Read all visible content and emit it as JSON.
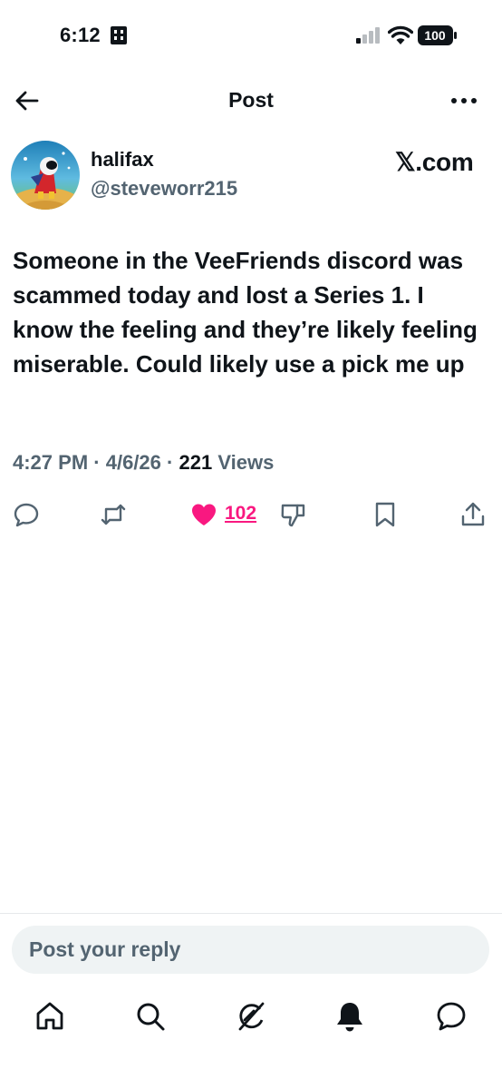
{
  "status_bar": {
    "time": "6:12",
    "battery": "100"
  },
  "header": {
    "title": "Post"
  },
  "author": {
    "name": "halifax",
    "handle": "@steveworr215"
  },
  "source_label": "𝕏.com",
  "post": {
    "text": "Someone in the VeeFriends discord was scammed today and lost a Series 1. I know the feeling and they’re likely feeling miserable. Could likely use a pick me up",
    "time": "4:27 PM",
    "separator": "·",
    "date": "4/6/26",
    "views_count": "221",
    "views_label": "Views"
  },
  "actions": {
    "like_count": "102"
  },
  "reply": {
    "placeholder": "Post your reply"
  },
  "colors": {
    "accent_like": "#f91880",
    "secondary_text": "#536471"
  },
  "icons": [
    "back-arrow-icon",
    "more-icon",
    "reply-icon",
    "retweet-icon",
    "heart-icon",
    "dislike-icon",
    "bookmark-icon",
    "share-icon",
    "home-icon",
    "search-icon",
    "grok-icon",
    "notifications-icon",
    "messages-icon"
  ]
}
